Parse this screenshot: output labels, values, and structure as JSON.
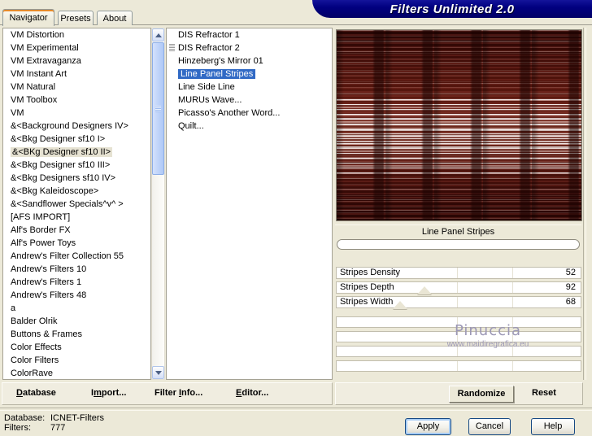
{
  "header": {
    "banner_title": "Filters Unlimited 2.0",
    "tabs": [
      {
        "label": "Navigator",
        "active": true
      },
      {
        "label": "Presets",
        "active": false
      },
      {
        "label": "About",
        "active": false
      }
    ]
  },
  "colors": {
    "window_bg": "#ECE9D8",
    "banner_bg": "#010080",
    "banner_text": "#FFFFFF",
    "tab_accent": "#E68B2C",
    "selection_active": "#316AC5",
    "selection_inactive": "#E6E2D2",
    "scrollbar_thumb": "#AEC8F6",
    "watermark_text": "#9B97B5",
    "preview_base": "#4C110A"
  },
  "navigator": {
    "categories": [
      {
        "label": "VM Distortion",
        "selected": false
      },
      {
        "label": "VM Experimental",
        "selected": false
      },
      {
        "label": "VM Extravaganza",
        "selected": false
      },
      {
        "label": "VM Instant Art",
        "selected": false
      },
      {
        "label": "VM Natural",
        "selected": false
      },
      {
        "label": "VM Toolbox",
        "selected": false
      },
      {
        "label": "VM",
        "selected": false
      },
      {
        "label": "&<Background Designers IV>",
        "selected": false
      },
      {
        "label": "&<Bkg Designer sf10 I>",
        "selected": false
      },
      {
        "label": "&<BKg Designer sf10 II>",
        "selected": true
      },
      {
        "label": "&<Bkg Designer sf10 III>",
        "selected": false
      },
      {
        "label": "&<Bkg Designers sf10 IV>",
        "selected": false
      },
      {
        "label": "&<Bkg Kaleidoscope>",
        "selected": false
      },
      {
        "label": "&<Sandflower Specials^v^ >",
        "selected": false
      },
      {
        "label": "[AFS IMPORT]",
        "selected": false
      },
      {
        "label": "Alf's Border FX",
        "selected": false
      },
      {
        "label": "Alf's Power Toys",
        "selected": false
      },
      {
        "label": "Andrew's Filter Collection 55",
        "selected": false
      },
      {
        "label": "Andrew's Filters 10",
        "selected": false
      },
      {
        "label": "Andrew's Filters 1",
        "selected": false
      },
      {
        "label": "Andrew's Filters 48",
        "selected": false
      },
      {
        "label": "a",
        "selected": false
      },
      {
        "label": "Balder Olrik",
        "selected": false
      },
      {
        "label": "Buttons & Frames",
        "selected": false
      },
      {
        "label": "Color Effects",
        "selected": false
      },
      {
        "label": "Color Filters",
        "selected": false
      },
      {
        "label": "ColorRave",
        "selected": false
      }
    ],
    "filters": [
      {
        "label": "DIS Refractor 1",
        "selected": false,
        "icon": ""
      },
      {
        "label": "DIS Refractor 2",
        "selected": false,
        "icon": "list-lines-icon"
      },
      {
        "label": "Hinzeberg's Mirror 01",
        "selected": false,
        "icon": ""
      },
      {
        "label": "Line Panel Stripes",
        "selected": true,
        "icon": ""
      },
      {
        "label": "Line Side Line",
        "selected": false,
        "icon": ""
      },
      {
        "label": "MURUs Wave...",
        "selected": false,
        "icon": ""
      },
      {
        "label": "Picasso's Another Word...",
        "selected": false,
        "icon": ""
      },
      {
        "label": "Quilt...",
        "selected": false,
        "icon": ""
      }
    ]
  },
  "controls": {
    "filter_title": "Line Panel Stripes",
    "sliders": [
      {
        "label": "Stripes Density",
        "value": "52",
        "thumb_pct": null
      },
      {
        "label": "Stripes Depth",
        "value": "92",
        "thumb_pct": 36
      },
      {
        "label": "Stripes Width",
        "value": "68",
        "thumb_pct": 26
      }
    ],
    "watermark": {
      "name": "Pinuccia",
      "url": "www.maidiregrafica.eu"
    }
  },
  "toolbar": {
    "database": {
      "pre": "",
      "key": "D",
      "post": "atabase"
    },
    "import": {
      "pre": "I",
      "key": "m",
      "post": "port..."
    },
    "filter_info": {
      "pre": "Filter ",
      "key": "I",
      "post": "nfo..."
    },
    "editor": {
      "pre": "",
      "key": "E",
      "post": "ditor..."
    },
    "randomize": "Randomize",
    "reset": "Reset"
  },
  "status": {
    "database_label": "Database:",
    "database_value": "ICNET-Filters",
    "filters_label": "Filters:",
    "filters_value": "777"
  },
  "dialog_buttons": {
    "apply": "Apply",
    "cancel": "Cancel",
    "help": "Help"
  }
}
